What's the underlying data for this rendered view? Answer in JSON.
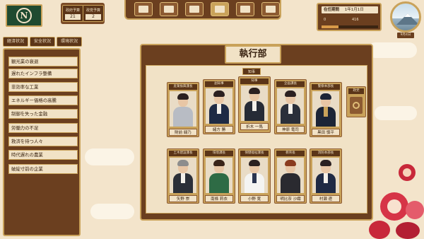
{
  "top": {
    "logo_glyph": "N",
    "stats": [
      {
        "label": "政府予算",
        "value": "21"
      },
      {
        "label": "政党予算",
        "value": "2"
      }
    ],
    "tools": [
      {
        "icon": "city-icon"
      },
      {
        "icon": "parliament-icon"
      },
      {
        "icon": "cabinet-icon"
      },
      {
        "icon": "executive-icon"
      },
      {
        "icon": "coin-icon"
      },
      {
        "icon": "book-icon"
      }
    ],
    "date": {
      "label": "在任期間",
      "value": "1年1月1日",
      "mini_left": "0",
      "mini_right": "416"
    },
    "season_label": "9月4日"
  },
  "left_tabs": [
    "経済状況",
    "安全状況",
    "環境状況"
  ],
  "issues": [
    "観光業の衰退",
    "遅れたインフラ整備",
    "非効率な工業",
    "エネルギー価格の高騰",
    "制御を失った金融",
    "労働力の不足",
    "救済を待つ人々",
    "時代遅れの農業",
    "破綻寸前の企業"
  ],
  "main": {
    "title": "執行部",
    "chief_tag": "知事",
    "vacancy_role": "政党",
    "members_top": [
      {
        "role": "産業振興課長",
        "name": "財前 緑乃"
      },
      {
        "role": "副知事",
        "name": "緒方 勝"
      },
      {
        "role": "知事",
        "name": "折木 一馬"
      },
      {
        "role": "企画課長",
        "name": "神原 竜司"
      },
      {
        "role": "警察本部長",
        "name": "黒田 慎平"
      }
    ],
    "members_bottom": [
      {
        "role": "土木建設課長",
        "name": "矢野 崇"
      },
      {
        "role": "環境課長",
        "name": "南條 莉衣"
      },
      {
        "role": "保健福祉課長",
        "name": "小野 寛"
      },
      {
        "role": "教育長",
        "name": "明比奈 沙織"
      },
      {
        "role": "消防本部長",
        "name": "村瀬 遼"
      }
    ]
  },
  "colors": {
    "wood": "#6b3f1f",
    "gold": "#c9a25a",
    "paper": "#f1e2c6",
    "logo_green": "#1f4a30"
  }
}
